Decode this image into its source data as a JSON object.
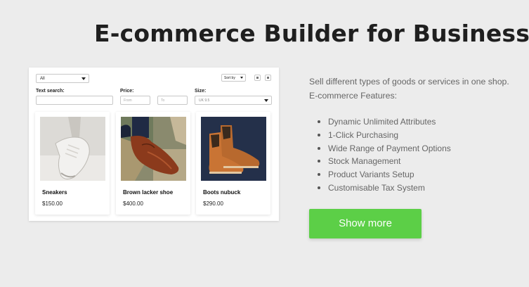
{
  "page": {
    "title": "E-commerce Builder for Business",
    "description_line1": "Sell different types of goods or services in one shop.",
    "description_line2": "E-commerce Features:",
    "features": [
      "Dynamic Unlimited Attributes",
      "1-Click Purchasing",
      "Wide Range of Payment Options",
      "Stock Management",
      "Product Variants Setup",
      "Customisable Tax System"
    ],
    "cta_label": "Show more",
    "cta_color": "#5ccf47"
  },
  "shop_preview": {
    "category_select": "All",
    "sort_select": "Sort by",
    "filters": {
      "text_search_label": "Text search:",
      "text_search_value": "",
      "price_label": "Price:",
      "price_from_placeholder": "From",
      "price_to_placeholder": "To",
      "size_label": "Size:",
      "size_value": "UK 9.5"
    },
    "products": [
      {
        "name": "Sneakers",
        "price": "$150.00",
        "image": "white-sneaker-photo"
      },
      {
        "name": "Brown lacker shoe",
        "price": "$400.00",
        "image": "brown-oxford-shoe-photo"
      },
      {
        "name": "Boots nubuck",
        "price": "$290.00",
        "image": "tan-chelsea-boots-photo"
      }
    ]
  }
}
